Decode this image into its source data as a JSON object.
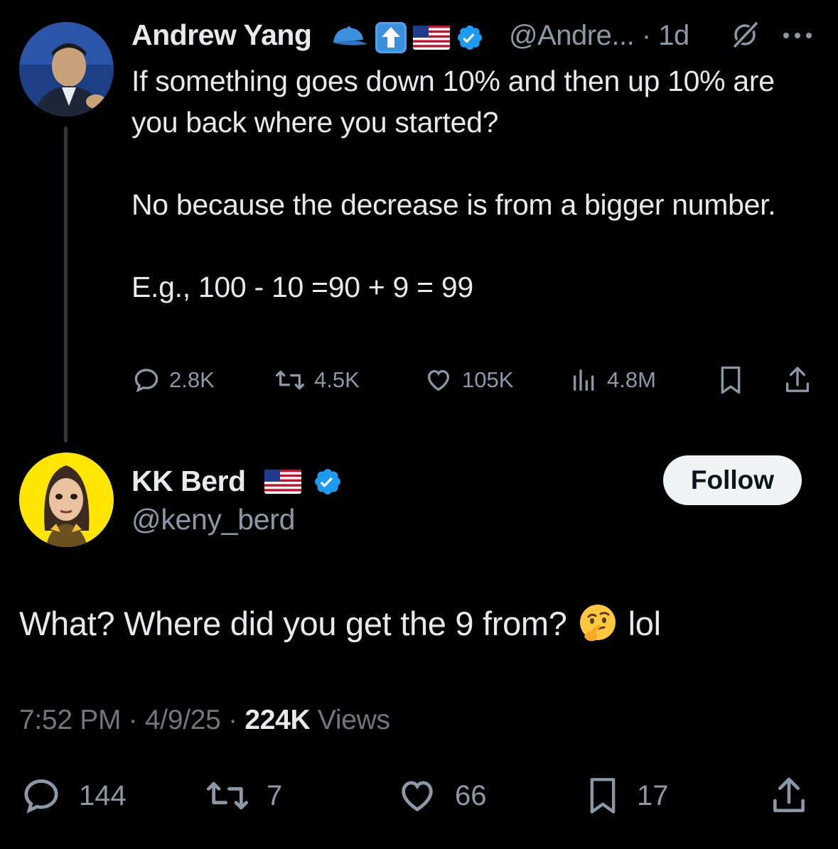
{
  "parent": {
    "display_name": "Andrew Yang",
    "handle": "@Andre...",
    "time": "· 1d",
    "text_lines": [
      "If something goes down 10% and then up 10% are you back where you started?",
      "No because the decrease is from a bigger number.",
      "E.g., 100 - 10 =90 + 9 = 99"
    ],
    "stats": {
      "replies": "2.8K",
      "reposts": "4.5K",
      "likes": "105K",
      "views": "4.8M"
    },
    "icons": [
      "cap-emoji",
      "up-arrow-emoji",
      "us-flag-emoji",
      "verified-badge-icon",
      "grok-icon",
      "more-icon"
    ]
  },
  "reply": {
    "display_name": "KK Berd",
    "handle": "@keny_berd",
    "follow_label": "Follow",
    "text": "What? Where did you get the 9 from?",
    "text_suffix": "lol",
    "timestamp": "7:52 PM · 4/9/25 ·",
    "views_count": "224K",
    "views_label": "Views",
    "stats": {
      "replies": "144",
      "reposts": "7",
      "likes": "66",
      "bookmarks": "17"
    }
  },
  "colors": {
    "background": "#000000",
    "text": "#e7e9ea",
    "muted": "#8b98a5",
    "verified": "#1d9bf0",
    "avatar_bg_reply": "#ffe600"
  }
}
